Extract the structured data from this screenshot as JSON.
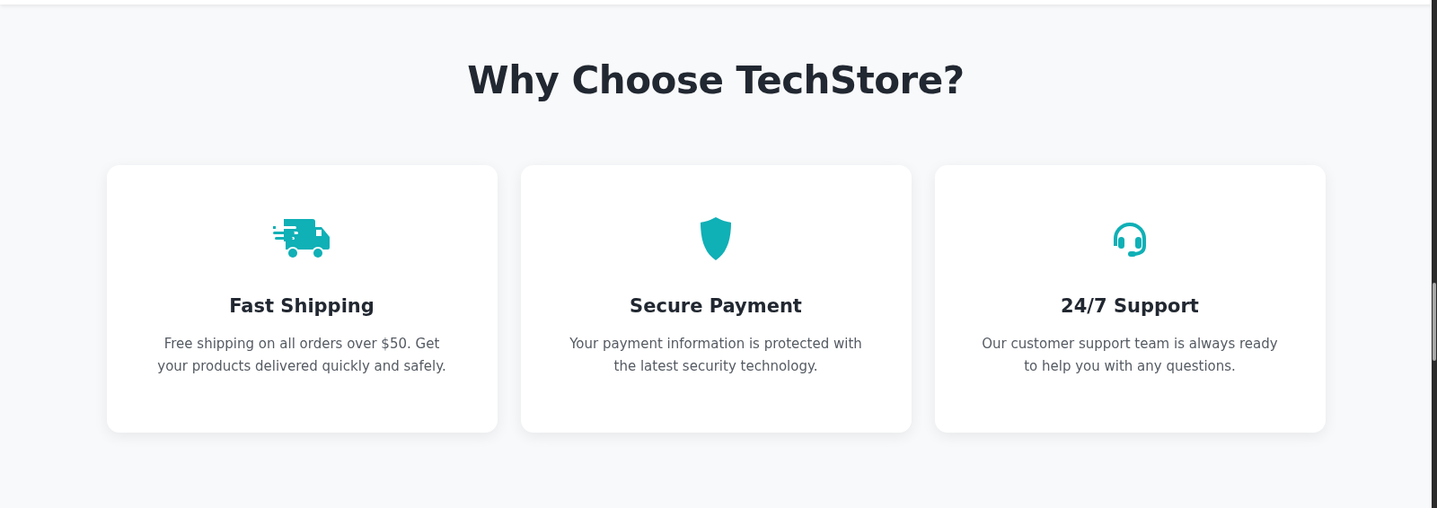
{
  "section": {
    "title": "Why Choose TechStore?"
  },
  "features": [
    {
      "kind": "truck",
      "title": "Fast Shipping",
      "description": "Free shipping on all orders over $50. Get your products delivered quickly and safely."
    },
    {
      "kind": "shield",
      "title": "Secure Payment",
      "description": "Your payment information is protected with the latest security technology."
    },
    {
      "kind": "headset",
      "title": "24/7 Support",
      "description": "Our customer support team is always ready to help you with any questions."
    }
  ]
}
